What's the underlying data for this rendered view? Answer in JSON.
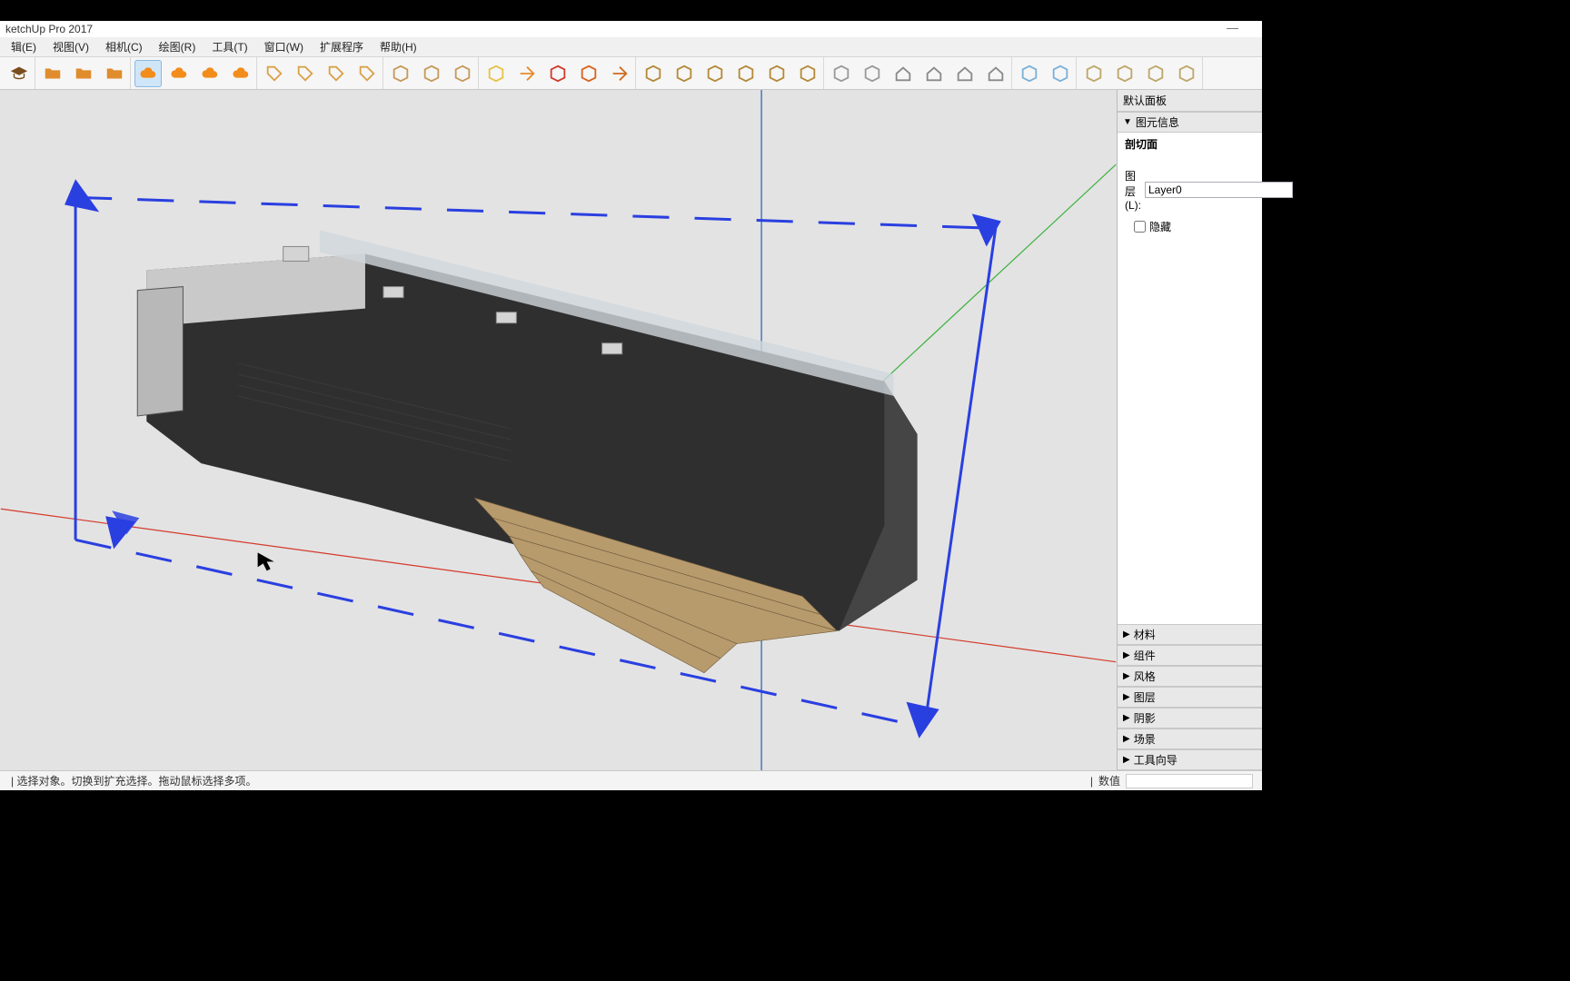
{
  "title": "ketchUp Pro 2017",
  "window_controls": {
    "minimize": "—",
    "close": ""
  },
  "menus": [
    "辑(E)",
    "视图(V)",
    "相机(C)",
    "绘图(R)",
    "工具(T)",
    "窗口(W)",
    "扩展程序",
    "帮助(H)"
  ],
  "tray": {
    "title": "默认面板",
    "entity_info": {
      "header": "图元信息",
      "entity_type": "剖切面",
      "layer_label": "图层(L):",
      "layer_value": "Layer0",
      "hidden_label": "隐藏"
    },
    "sections": [
      "材料",
      "组件",
      "风格",
      "图层",
      "阴影",
      "场景",
      "工具向导"
    ]
  },
  "status": {
    "left": "| 选择对象。切换到扩充选择。拖动鼠标选择多项。",
    "value_label": "数值"
  },
  "toolbar": {
    "groups": [
      [
        "grad-cap"
      ],
      [
        "folder-open",
        "folder-plus",
        "folder-x"
      ],
      [
        "cloud-active",
        "cloud-lines",
        "cloud-solid",
        "cloud-check"
      ],
      [
        "tag",
        "tag2",
        "tag3",
        "tag4"
      ],
      [
        "cube1",
        "cube2",
        "cube3"
      ],
      [
        "star-arrow",
        "arrow-orange",
        "slash-red",
        "para",
        "arrow-up"
      ],
      [
        "paint1",
        "paint2",
        "paint3",
        "paint4",
        "paint5",
        "paint6"
      ],
      [
        "box1",
        "box2",
        "house1",
        "house2",
        "house3",
        "house4"
      ],
      [
        "p1",
        "p2"
      ],
      [
        "s1",
        "s2",
        "s3",
        "s4"
      ]
    ],
    "active": "cloud-active"
  }
}
